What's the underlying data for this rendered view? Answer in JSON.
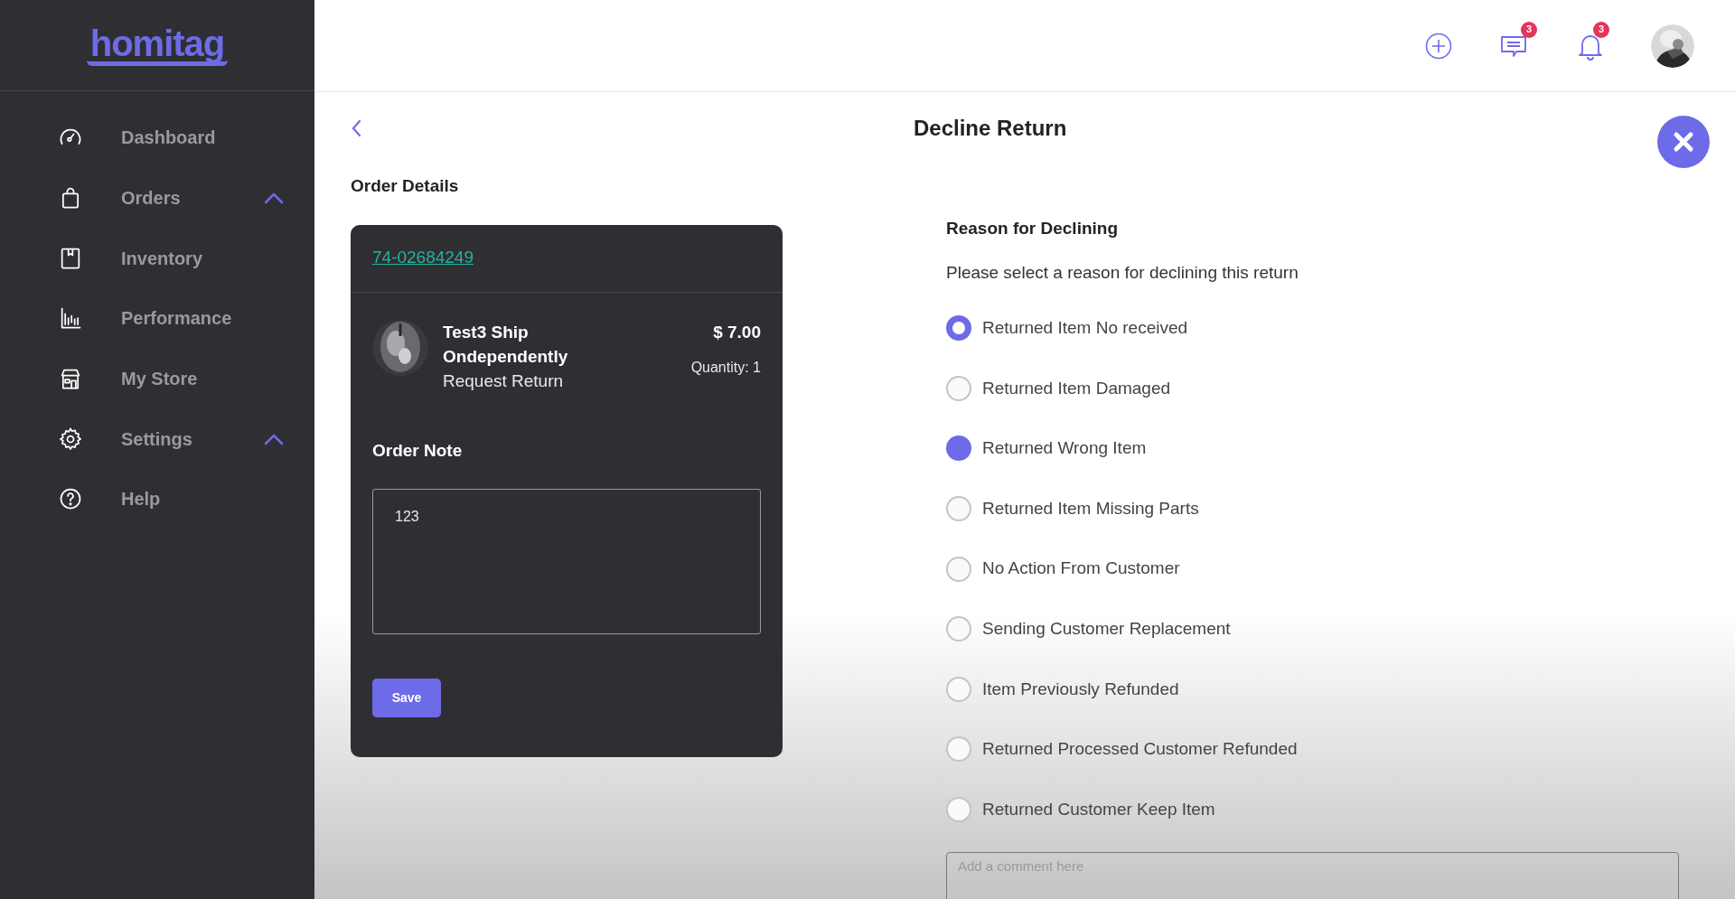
{
  "sidebar": {
    "logo": "homitag",
    "items": [
      {
        "label": "Dashboard",
        "kind": "link"
      },
      {
        "label": "Orders",
        "kind": "group"
      },
      {
        "label": "Inventory",
        "kind": "link"
      },
      {
        "label": "Performance",
        "kind": "link"
      },
      {
        "label": "My Store",
        "kind": "link"
      },
      {
        "label": "Settings",
        "kind": "group"
      },
      {
        "label": "Help",
        "kind": "link"
      }
    ]
  },
  "header": {
    "messages_badge": "3",
    "notifications_badge": "3"
  },
  "page": {
    "title": "Decline Return",
    "section_title": "Order Details"
  },
  "order": {
    "id": "74-02684249",
    "product_name": "Test3 Ship Ondependently",
    "status": "Request Return",
    "price": "$ 7.00",
    "quantity": "Quantity: 1",
    "note_title": "Order Note",
    "note_value": "123",
    "save_label": "Save"
  },
  "reasons": {
    "title": "Reason for Declining",
    "prompt": "Please select a reason for declining this return",
    "options": [
      {
        "label": "Returned Item No received",
        "selected": true,
        "hovered": false
      },
      {
        "label": "Returned Item Damaged",
        "selected": false,
        "hovered": false
      },
      {
        "label": "Returned Wrong Item",
        "selected": false,
        "hovered": true
      },
      {
        "label": "Returned Item Missing Parts",
        "selected": false,
        "hovered": false
      },
      {
        "label": "No Action From Customer",
        "selected": false,
        "hovered": false
      },
      {
        "label": "Sending Customer Replacement",
        "selected": false,
        "hovered": false
      },
      {
        "label": "Item Previously Refunded",
        "selected": false,
        "hovered": false
      },
      {
        "label": "Returned Processed Customer Refunded",
        "selected": false,
        "hovered": false
      },
      {
        "label": "Returned Customer Keep Item",
        "selected": false,
        "hovered": false
      }
    ],
    "comment_placeholder": "Add a comment here"
  }
}
